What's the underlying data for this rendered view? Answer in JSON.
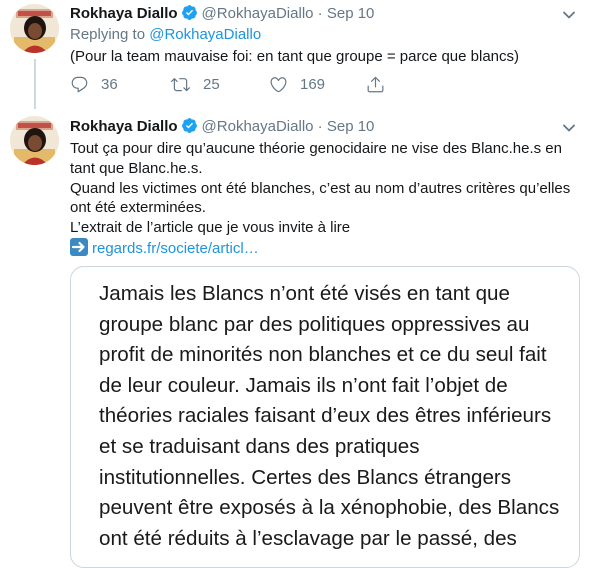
{
  "tweets": [
    {
      "author_name": "Rokhaya Diallo",
      "handle": "@RokhayaDiallo",
      "separator": "·",
      "date": "Sep 10",
      "replying_prefix": "Replying to",
      "replying_to": "@RokhayaDiallo",
      "text": "(Pour la team mauvaise foi: en tant que groupe = parce que blancs)",
      "replies": "36",
      "retweets": "25",
      "likes": "169"
    },
    {
      "author_name": "Rokhaya Diallo",
      "handle": "@RokhayaDiallo",
      "separator": "·",
      "date": "Sep 10",
      "paragraphs": [
        "Tout ça pour dire qu’aucune théorie genocidaire ne vise des Blanc.he.s en tant que Blanc.he.s.",
        "Quand les victimes ont été blanches, c’est au nom d’autres critères qu’elles ont été exterminées.",
        "L’extrait de l’article que je vous invite à lire"
      ],
      "link_text": "regards.fr/societe/articl…",
      "quote_text": "Jamais les Blancs n’ont été visés en tant que groupe blanc par des politiques oppressives au profit de minorités non blanches et ce du seul fait de leur couleur. Jamais ils n’ont fait l’objet de théories raciales faisant d’eux des êtres inférieurs et se traduisant dans des pratiques institutionnelles. Certes des Blancs étrangers peuvent être exposés à la xénophobie, des Blancs ont été réduits à l’esclavage par le passé, des"
    }
  ],
  "colors": {
    "link": "#1b95e0",
    "muted": "#657786",
    "verified": "#1da1f2",
    "thread_line": "#cfd9de"
  },
  "icons": [
    "chevron-down-icon",
    "verified-badge-icon",
    "reply-icon",
    "retweet-icon",
    "like-icon",
    "share-icon",
    "right-arrow-emoji-icon"
  ]
}
